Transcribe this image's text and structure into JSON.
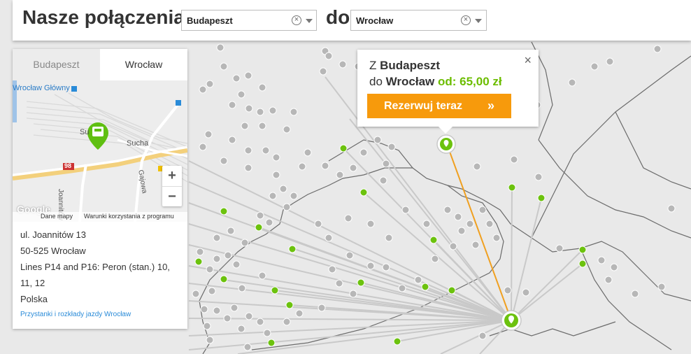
{
  "header": {
    "title": "Nasze połączenia z",
    "connector": "do",
    "from_value": "Budapeszt",
    "to_value": "Wrocław"
  },
  "panel": {
    "tabs": [
      {
        "label": "Budapeszt"
      },
      {
        "label": "Wrocław"
      }
    ],
    "minimap": {
      "station_label": "Wrocław Główny",
      "street_sucha": "Sucha",
      "street_su": "Su",
      "street_joannitow": "Joannitów",
      "street_gajowa": "Gajowa",
      "road_number": "98",
      "zoom_in": "+",
      "zoom_out": "−",
      "google_logo": "Google",
      "map_data": "Dane mapy",
      "terms": "Warunki korzystania z programu"
    },
    "address": [
      "ul. Joannitów 13",
      "50-525 Wrocław",
      "Lines P14 and P16: Peron (stan.) 10, 11, 12",
      "Polska"
    ],
    "link": "Przystanki i rozkłady jazdy Wrocław"
  },
  "popup": {
    "z": "Z",
    "origin": "Budapeszt",
    "do": "do",
    "destination": "Wrocław",
    "price": "od: 65,00 zł",
    "button": "Rezerwuj teraz",
    "close": "×"
  },
  "colors": {
    "accent_orange": "#f79a0c",
    "accent_green": "#6cbd00",
    "route_gray": "#c8c8c8",
    "stop_gray": "#b0b0b0"
  }
}
